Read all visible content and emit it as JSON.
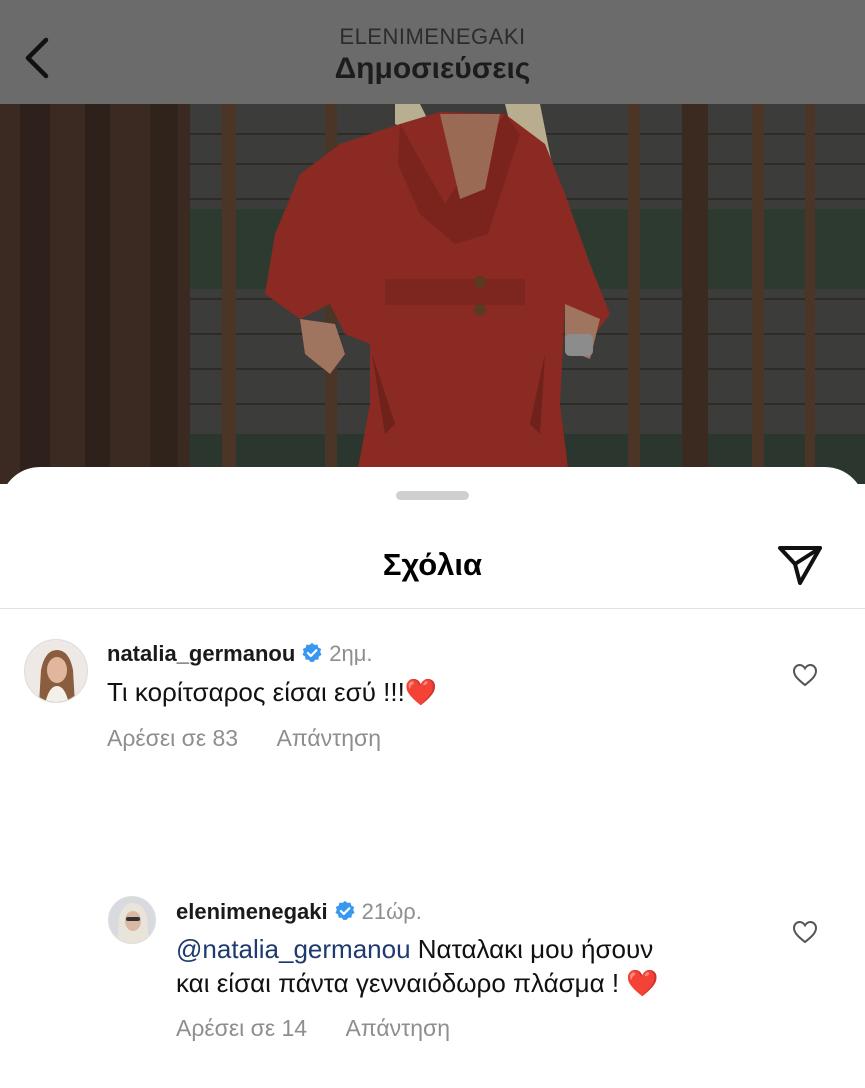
{
  "header": {
    "username": "ELENIMENEGAKI",
    "title": "Δημοσιεύσεις"
  },
  "comments_sheet": {
    "title": "Σχόλια",
    "comments": [
      {
        "username": "natalia_germanou",
        "verified": true,
        "time": "2ημ.",
        "text": "Τι κορίτσαρος είσαι εσύ !!!",
        "emoji": "❤️",
        "likes": "Αρέσει σε 83",
        "reply_label": "Απάντηση"
      },
      {
        "username": "elenimenegaki",
        "verified": true,
        "time": "21ώρ.",
        "mention": "@natalia_germanou",
        "text_line1": "Ναταλακι μου ήσουν",
        "text_line2": "και είσαι πάντα γενναιόδωρο πλάσμα !",
        "emoji": "❤️",
        "likes": "Αρέσει σε 14",
        "reply_label": "Απάντηση"
      }
    ]
  },
  "colors": {
    "verified_blue": "#3897f0",
    "overlay_gray": "#6b6b6b",
    "outfit_red": "#8a2a22",
    "heart_red": "#e0162b"
  },
  "icons": [
    "back-chevron-icon",
    "share-send-icon",
    "verified-badge-icon",
    "heart-outline-icon",
    "red-heart-emoji"
  ]
}
